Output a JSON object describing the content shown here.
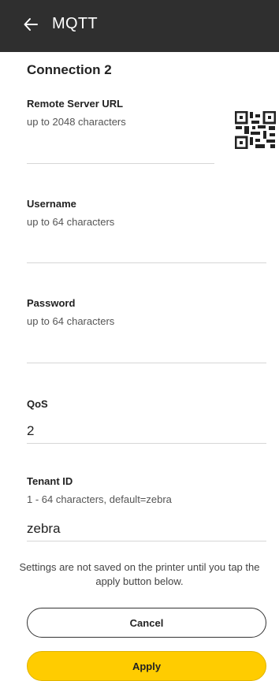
{
  "appbar": {
    "title": "MQTT",
    "back_icon": "arrow-left-icon"
  },
  "section": {
    "title": "Connection 2"
  },
  "fields": {
    "remote_url": {
      "label": "Remote Server URL",
      "hint": "up to 2048 characters",
      "value": "",
      "scan_icon": "qr-code-icon"
    },
    "username": {
      "label": "Username",
      "hint": "up to 64 characters",
      "value": ""
    },
    "password": {
      "label": "Password",
      "hint": "up to 64 characters",
      "value": ""
    },
    "qos": {
      "label": "QoS",
      "value": "2"
    },
    "tenant_id": {
      "label": "Tenant ID",
      "hint": "1 - 64 characters, default=zebra",
      "value": "zebra"
    }
  },
  "note": "Settings are not saved on the printer until you tap the apply button below.",
  "buttons": {
    "cancel": "Cancel",
    "apply": "Apply"
  },
  "colors": {
    "appbar": "#2f2f2f",
    "accent": "#ffcc00"
  }
}
